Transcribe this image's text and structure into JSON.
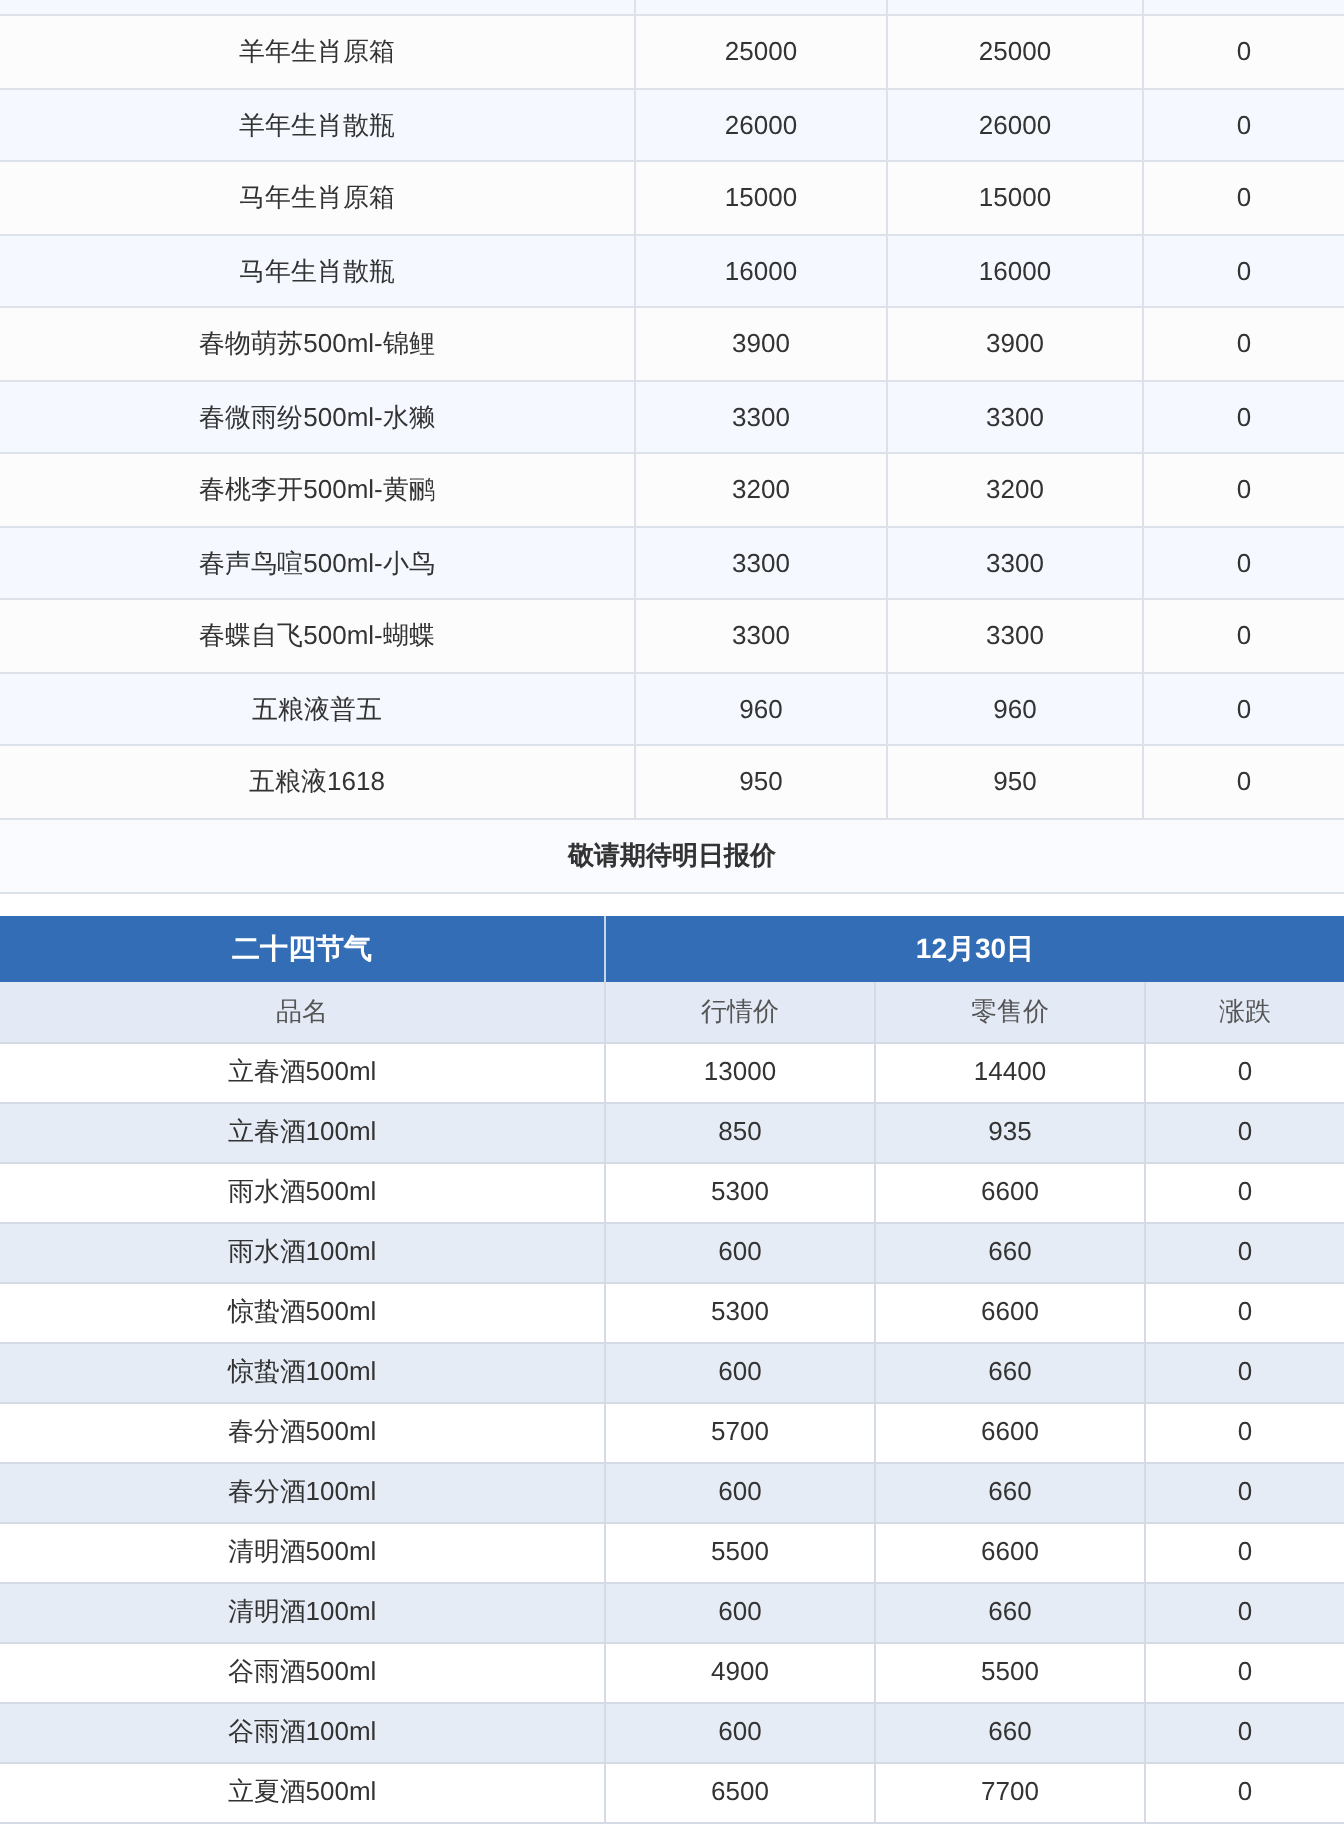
{
  "price_table": {
    "rows": [
      {
        "name": "羊年生肖原箱",
        "market_price": "25000",
        "retail_price": "25000",
        "change": "0"
      },
      {
        "name": "羊年生肖散瓶",
        "market_price": "26000",
        "retail_price": "26000",
        "change": "0"
      },
      {
        "name": "马年生肖原箱",
        "market_price": "15000",
        "retail_price": "15000",
        "change": "0"
      },
      {
        "name": "马年生肖散瓶",
        "market_price": "16000",
        "retail_price": "16000",
        "change": "0"
      },
      {
        "name": "春物萌苏500ml-锦鲤",
        "market_price": "3900",
        "retail_price": "3900",
        "change": "0"
      },
      {
        "name": "春微雨纷500ml-水獭",
        "market_price": "3300",
        "retail_price": "3300",
        "change": "0"
      },
      {
        "name": "春桃李开500ml-黄鹂",
        "market_price": "3200",
        "retail_price": "3200",
        "change": "0"
      },
      {
        "name": "春声鸟喧500ml-小鸟",
        "market_price": "3300",
        "retail_price": "3300",
        "change": "0"
      },
      {
        "name": "春蝶自飞500ml-蝴蝶",
        "market_price": "3300",
        "retail_price": "3300",
        "change": "0"
      },
      {
        "name": "五粮液普五",
        "market_price": "960",
        "retail_price": "960",
        "change": "0"
      },
      {
        "name": "五粮液1618",
        "market_price": "950",
        "retail_price": "950",
        "change": "0"
      }
    ],
    "note": "敬请期待明日报价"
  },
  "solar_terms_table": {
    "title": "二十四节气",
    "date": "12月30日",
    "columns": [
      "品名",
      "行情价",
      "零售价",
      "涨跌"
    ],
    "rows": [
      {
        "name": "立春酒500ml",
        "market_price": "13000",
        "retail_price": "14400",
        "change": "0"
      },
      {
        "name": "立春酒100ml",
        "market_price": "850",
        "retail_price": "935",
        "change": "0"
      },
      {
        "name": "雨水酒500ml",
        "market_price": "5300",
        "retail_price": "6600",
        "change": "0"
      },
      {
        "name": "雨水酒100ml",
        "market_price": "600",
        "retail_price": "660",
        "change": "0"
      },
      {
        "name": "惊蛰酒500ml",
        "market_price": "5300",
        "retail_price": "6600",
        "change": "0"
      },
      {
        "name": "惊蛰酒100ml",
        "market_price": "600",
        "retail_price": "660",
        "change": "0"
      },
      {
        "name": "春分酒500ml",
        "market_price": "5700",
        "retail_price": "6600",
        "change": "0"
      },
      {
        "name": "春分酒100ml",
        "market_price": "600",
        "retail_price": "660",
        "change": "0"
      },
      {
        "name": "清明酒500ml",
        "market_price": "5500",
        "retail_price": "6600",
        "change": "0"
      },
      {
        "name": "清明酒100ml",
        "market_price": "600",
        "retail_price": "660",
        "change": "0"
      },
      {
        "name": "谷雨酒500ml",
        "market_price": "4900",
        "retail_price": "5500",
        "change": "0"
      },
      {
        "name": "谷雨酒100ml",
        "market_price": "600",
        "retail_price": "660",
        "change": "0"
      },
      {
        "name": "立夏酒500ml",
        "market_price": "6500",
        "retail_price": "7700",
        "change": "0"
      }
    ]
  }
}
